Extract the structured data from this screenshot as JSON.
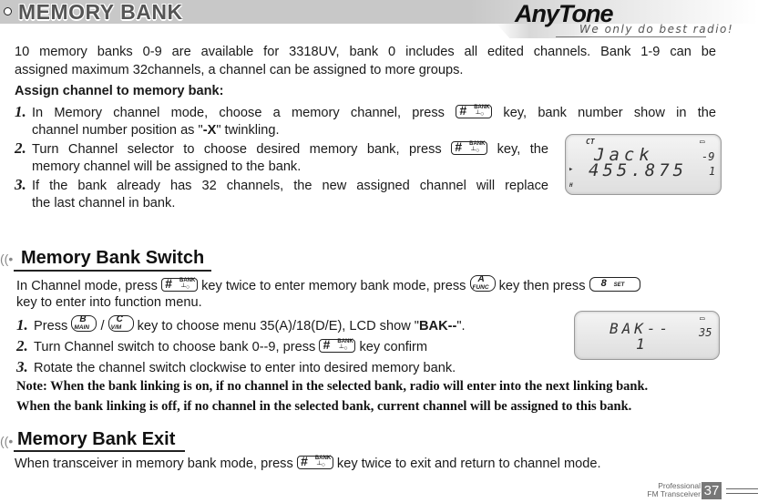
{
  "header": {
    "title": "MEMORY BANK",
    "logo": "AnyTone",
    "tagline": "We only do best radio!"
  },
  "intro": {
    "text_line1": "10 memory banks 0-9 are available for 3318UV, bank 0 includes all edited channels. Bank 1-9 can be",
    "text_line2": "assigned maximum 32channels, a channel can be assigned to more groups."
  },
  "assign": {
    "heading": "Assign channel to memory bank:",
    "steps": [
      {
        "num": "1.",
        "a": "In Memory channel mode, choose a memory channel, press",
        "b": "key, bank number show in the",
        "c1": "channel number position as \"",
        "c_bold": "-X",
        "c2": "\"  twinkling."
      },
      {
        "num": "2.",
        "a": "Turn Channel selector to choose desired memory bank, press",
        "b": "key, the",
        "c": "memory channel will be assigned to the bank."
      },
      {
        "num": "3.",
        "a": "If the bank already has 32 channels, the new assigned channel will replace",
        "c": "the last channel in bank."
      }
    ]
  },
  "lcd1": {
    "ct": "CT",
    "name": "Jack",
    "freq": "455.875",
    "bank": "-9",
    "ch": "1",
    "h": "H",
    "arrow": "▸"
  },
  "switch": {
    "title": "Memory Bank Switch",
    "p1_a": "In Channel mode, press",
    "p1_b": "key twice to enter memory bank mode, press",
    "p1_c": "key then press",
    "p1_d": "key to enter into function menu.",
    "steps": [
      {
        "num": "1.",
        "a": "Press",
        "sep": "/",
        "b": "key to choose menu 35(A)/18(D/E), LCD show \"",
        "bold": "BAK--",
        "c": "\"."
      },
      {
        "num": "2.",
        "a": "Turn Channel switch to choose bank 0--9, press",
        "b": "key confirm"
      },
      {
        "num": "3.",
        "a": "Rotate the channel switch clockwise to enter into desired memory bank."
      }
    ],
    "note1": "Note: When the bank linking is on, if no channel in the selected bank, radio will enter into the next linking bank.",
    "note2": "When the bank linking is off, if no channel in the selected bank, current channel will be assigned to this bank."
  },
  "lcd2": {
    "text": "BAK--",
    "value": "1",
    "menu": "35"
  },
  "keys": {
    "hash": "#",
    "bank": "BANK",
    "bank_sym": "┴○",
    "a": "A",
    "func": "FUNC",
    "b": "B",
    "main": "MAIN",
    "c": "C",
    "vm": "V/M",
    "eight": "8",
    "set": "SET"
  },
  "exit": {
    "title": "Memory Bank Exit",
    "p_a": "When transceiver in memory bank mode, press",
    "p_b": "key twice to exit and return to channel mode."
  },
  "footer": {
    "line1": "Professional",
    "line2": "FM Transceiver",
    "page": "37"
  }
}
